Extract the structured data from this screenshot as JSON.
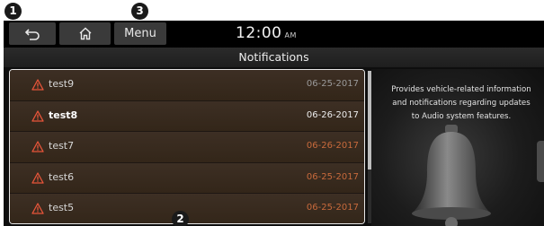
{
  "callouts": {
    "c1": "1",
    "c2": "2",
    "c3": "3"
  },
  "topbar": {
    "back_icon": "back-arrow-icon",
    "home_icon": "home-icon",
    "menu_label": "Menu",
    "time": "12:00",
    "ampm": "AM"
  },
  "page_title": "Notifications",
  "notifications": [
    {
      "title": "test9",
      "date": "06-25-2017",
      "style": "read"
    },
    {
      "title": "test8",
      "date": "06-26-2017",
      "style": "bright"
    },
    {
      "title": "test7",
      "date": "06-26-2017",
      "style": "orange"
    },
    {
      "title": "test6",
      "date": "06-25-2017",
      "style": "orange"
    },
    {
      "title": "test5",
      "date": "06-25-2017",
      "style": "orange"
    }
  ],
  "side_panel": {
    "line1": "Provides vehicle-related information",
    "line2": "and notifications regarding updates",
    "line3": "to Audio system features."
  },
  "colors": {
    "warning": "#e8553a",
    "row_background": "#3a2d22",
    "accent_date": "#c86a3c"
  }
}
